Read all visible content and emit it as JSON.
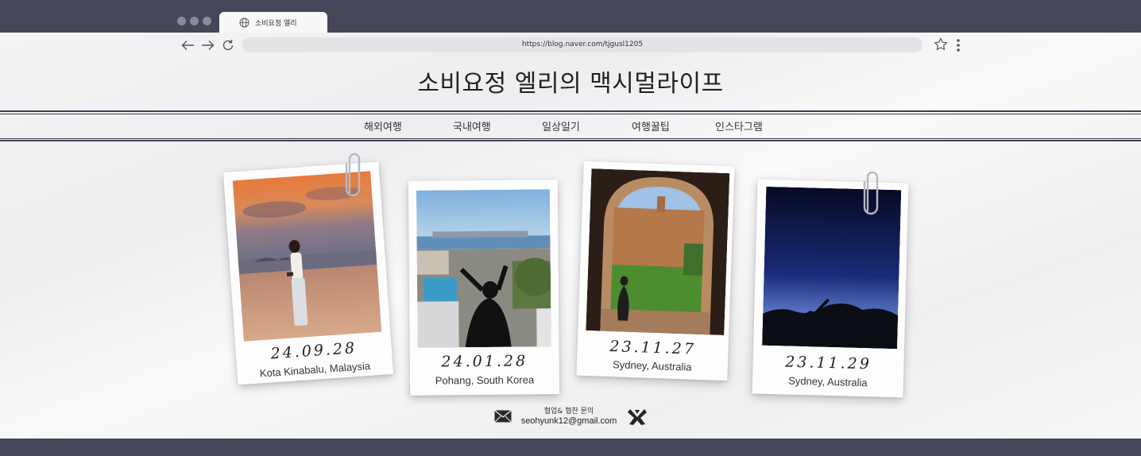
{
  "browser": {
    "tab_title": "소비요정 엘리",
    "url": "https://blog.naver.com/tjgusl1205"
  },
  "blog": {
    "title": "소비요정 엘리의 맥시멀라이프",
    "menu": [
      {
        "label": "해외여행"
      },
      {
        "label": "국내여행"
      },
      {
        "label": "일상일기"
      },
      {
        "label": "여행꿀팁"
      },
      {
        "label": "인스타그램"
      }
    ]
  },
  "polaroids": [
    {
      "date": "24.09.28",
      "place": "Kota Kinabalu, Malaysia"
    },
    {
      "date": "24.01.28",
      "place": "Pohang, South Korea"
    },
    {
      "date": "23.11.27",
      "place": "Sydney, Australia"
    },
    {
      "date": "23.11.29",
      "place": "Sydney, Australia"
    }
  ],
  "contact": {
    "label": "협업& 협찬 문의",
    "email": "seohyunk12@gmail.com"
  },
  "icons": {
    "tab": "globe-icon",
    "back": "arrow-left-icon",
    "forward": "arrow-right-icon",
    "reload": "reload-icon",
    "bookmark": "star-icon",
    "menu": "kebab-menu-icon",
    "mail": "mail-icon",
    "blog": "blog-logo-icon",
    "clip": "paperclip-icon"
  },
  "colors": {
    "chrome": "#454659",
    "page_bg": "#f4f4f5",
    "rule": "#3d3e52"
  }
}
